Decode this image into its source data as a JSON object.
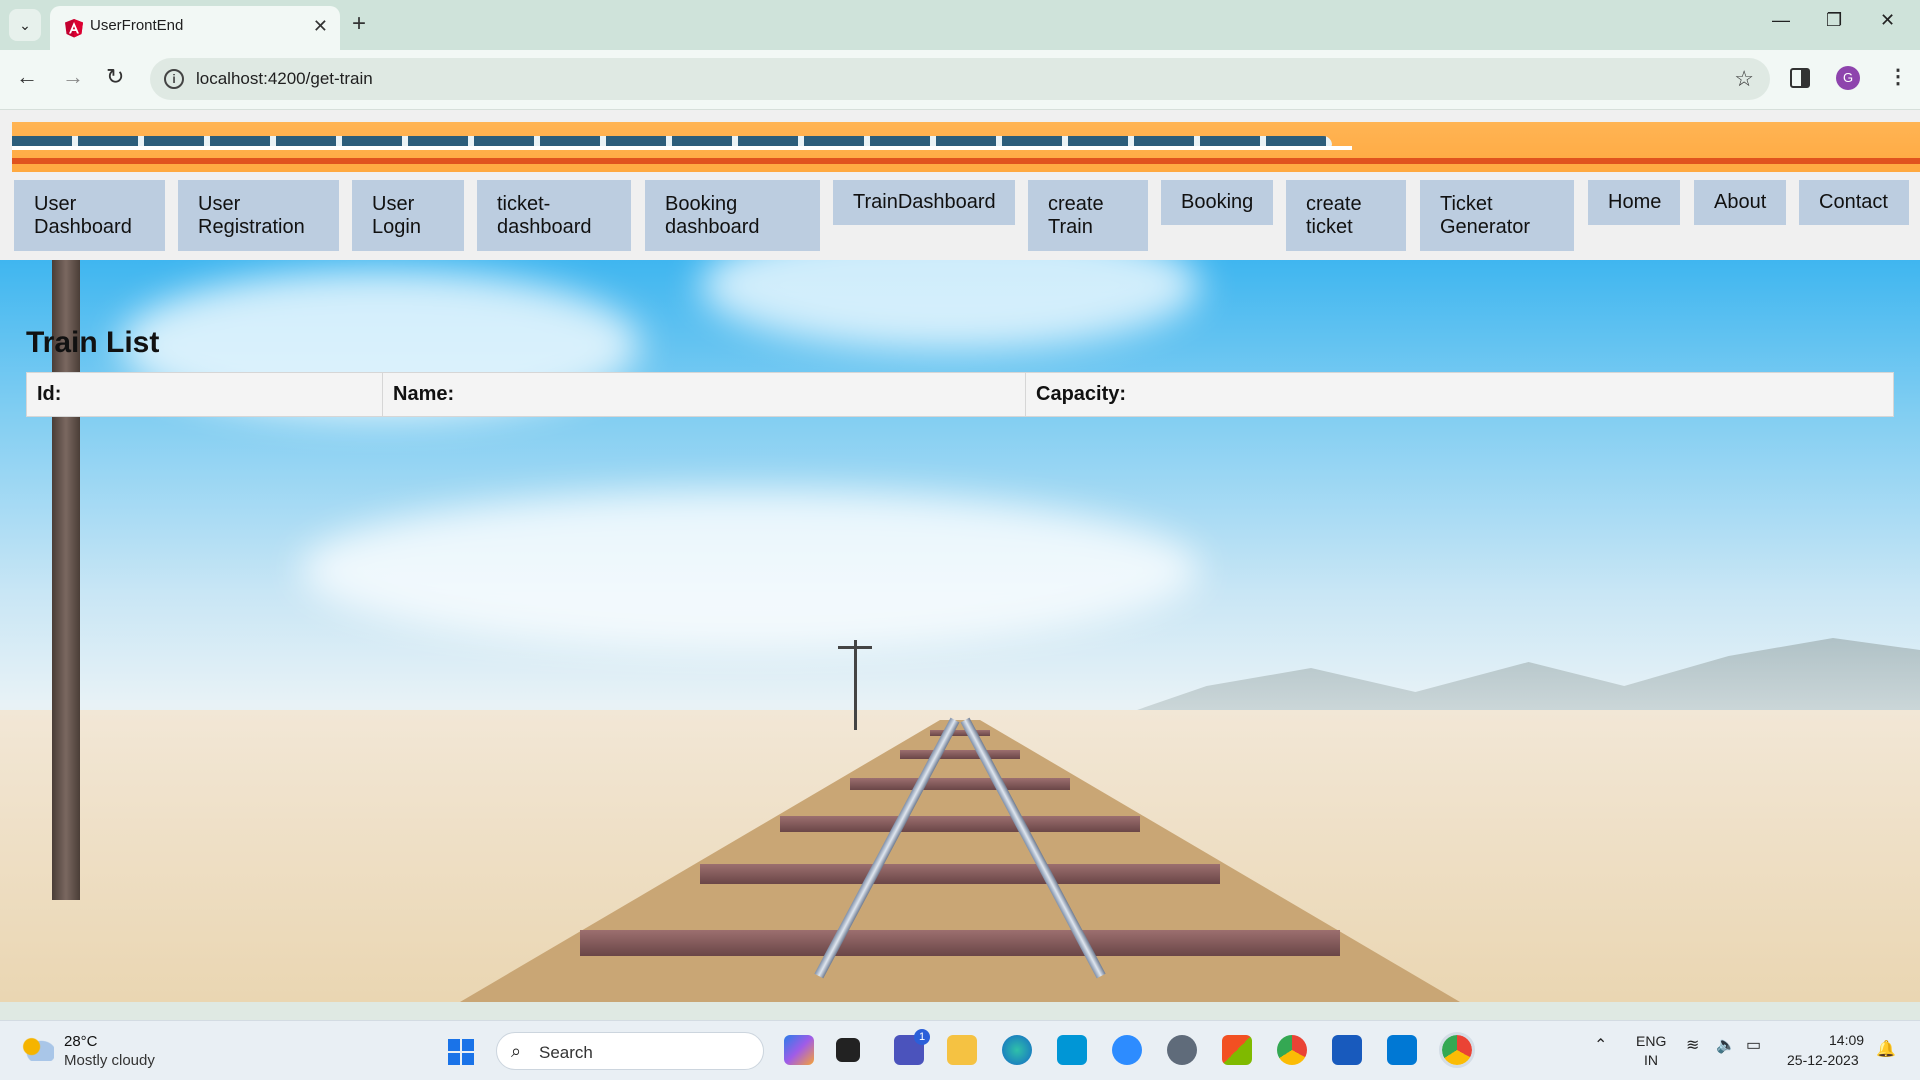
{
  "browser": {
    "tab_title": "UserFrontEnd",
    "url": "localhost:4200/get-train",
    "profile_initial": "G"
  },
  "nav": {
    "items": [
      {
        "label": "User Dashboard"
      },
      {
        "label": "User Registration"
      },
      {
        "label": "User Login"
      },
      {
        "label": "ticket-dashboard"
      },
      {
        "label": "Booking dashboard"
      },
      {
        "label": "TrainDashboard"
      },
      {
        "label": "create Train"
      },
      {
        "label": "Booking"
      },
      {
        "label": "create ticket"
      },
      {
        "label": "Ticket Generator"
      },
      {
        "label": "Home"
      },
      {
        "label": "About"
      },
      {
        "label": "Contact"
      }
    ]
  },
  "main": {
    "title": "Train List",
    "table": {
      "headers": [
        "Id:",
        "Name:",
        "Capacity:"
      ]
    }
  },
  "taskbar": {
    "weather_temp": "28°C",
    "weather_desc": "Mostly cloudy",
    "search_placeholder": "Search",
    "lang_line1": "ENG",
    "lang_line2": "IN",
    "time": "14:09",
    "date": "25-12-2023",
    "teams_badge": "1"
  },
  "icons": {
    "tab_search": "chevron-down-icon",
    "favicon": "angular-icon",
    "back": "back-arrow-icon",
    "forward": "forward-arrow-icon",
    "reload": "reload-icon",
    "bookmark": "star-icon",
    "sidepanel": "side-panel-icon",
    "menu": "kebab-menu-icon"
  },
  "colors": {
    "nav_button_bg": "#bccde0",
    "banner_orange": "#ffa940",
    "sky_blue": "#3fb6f0"
  }
}
